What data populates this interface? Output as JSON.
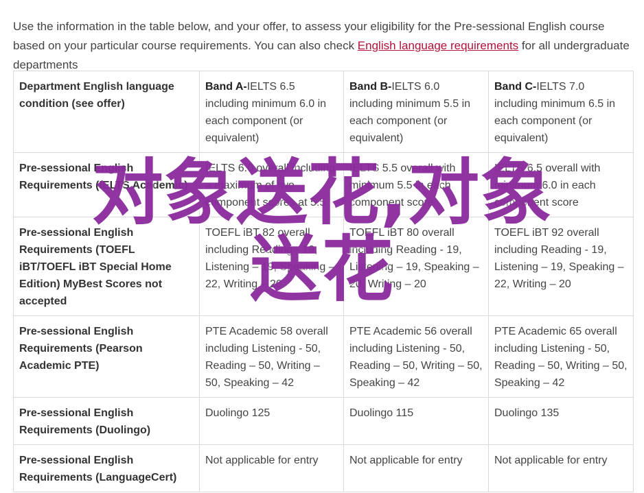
{
  "intro": {
    "text_before": "Use the information in the table below, and your offer, to assess your eligibility for the Pre-sessional English course based on your particular course requirements. You can also check ",
    "link_text": "English language requirements",
    "text_after": " for all undergraduate departments"
  },
  "table": {
    "header": {
      "label": "Department English language condition (see offer)",
      "bands": [
        {
          "name": "Band A-",
          "text": "IELTS 6.5 including minimum 6.0 in each component (or equivalent)"
        },
        {
          "name": "Band B-",
          "text": "IELTS 6.0 including minimum 5.5 in each component (or equivalent)"
        },
        {
          "name": "Band C-",
          "text": "IELTS 7.0 including minimum 6.5 in each component (or equivalent)"
        }
      ]
    },
    "rows": [
      {
        "label": "Pre-sessional English Requirements (IELTS Academic)",
        "cells": [
          "IELTS 6.0 overall including a maximum of two component scores at 5.5",
          "IELTS 5.5 overall with minimum 5.5 in each component score",
          "IELTS 6.5 overall with minimum 6.0 in each component score"
        ]
      },
      {
        "label": "Pre-sessional English Requirements (TOEFL iBT/TOEFL iBT Special Home Edition) MyBest Scores not accepted",
        "cells": [
          "TOEFL iBT 82 overall including Reading - 19, Listening – 19, Speaking – 22, Writing – 20",
          "TOEFL iBT 80 overall including Reading - 19, Listening – 19, Speaking – 20, Writing – 20",
          "TOEFL iBT 92 overall including Reading - 19, Listening – 19, Speaking – 22, Writing – 20"
        ]
      },
      {
        "label": "Pre-sessional English Requirements (Pearson Academic PTE)",
        "cells": [
          "PTE Academic 58 overall including Listening - 50, Reading – 50, Writing – 50, Speaking – 42",
          "PTE Academic 56 overall including Listening - 50, Reading – 50, Writing – 50, Speaking – 42",
          "PTE Academic 65 overall including Listening - 50, Reading – 50, Writing – 50, Speaking – 42"
        ]
      },
      {
        "label": "Pre-sessional English Requirements (Duolingo)",
        "cells": [
          "Duolingo 125",
          "Duolingo 115",
          "Duolingo 135"
        ]
      },
      {
        "label": "Pre-sessional English Requirements (LanguageCert)",
        "cells": [
          "Not applicable for entry",
          "Not applicable for entry",
          "Not applicable for entry"
        ]
      }
    ]
  },
  "watermark": {
    "line1": "对象送花,对象",
    "line2": "送花",
    "color": "#8b2a9e"
  },
  "colors": {
    "link": "#b0123a",
    "border": "#d9d9d9",
    "text": "#444444"
  }
}
